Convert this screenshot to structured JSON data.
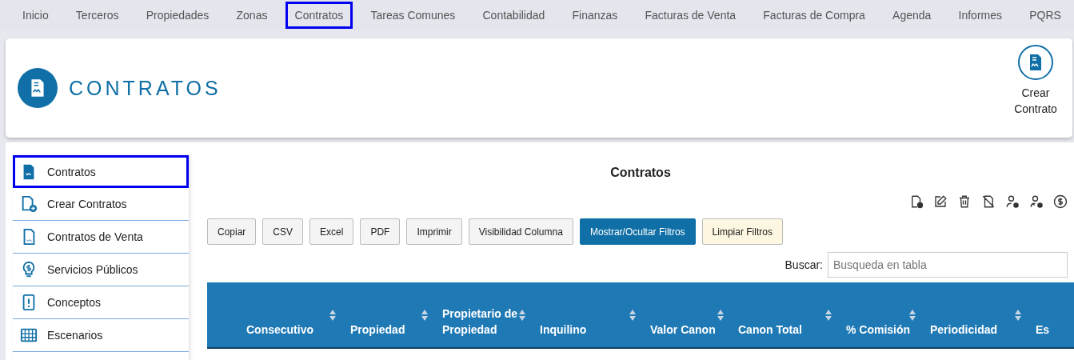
{
  "nav": [
    {
      "label": "Inicio",
      "selected": false
    },
    {
      "label": "Terceros",
      "selected": false
    },
    {
      "label": "Propiedades",
      "selected": false
    },
    {
      "label": "Zonas",
      "selected": false
    },
    {
      "label": "Contratos",
      "selected": true
    },
    {
      "label": "Tareas Comunes",
      "selected": false
    },
    {
      "label": "Contabilidad",
      "selected": false
    },
    {
      "label": "Finanzas",
      "selected": false
    },
    {
      "label": "Facturas de Venta",
      "selected": false
    },
    {
      "label": "Facturas de Compra",
      "selected": false
    },
    {
      "label": "Agenda",
      "selected": false
    },
    {
      "label": "Informes",
      "selected": false
    },
    {
      "label": "PQRS",
      "selected": false
    }
  ],
  "header": {
    "title": "CONTRATOS",
    "action": "Crear Contrato"
  },
  "sidebar": {
    "items": [
      {
        "label": "Contratos",
        "selected": true
      },
      {
        "label": "Crear Contratos",
        "selected": false
      },
      {
        "label": "Contratos de Venta",
        "selected": false
      },
      {
        "label": "Servicios Públicos",
        "selected": false
      },
      {
        "label": "Conceptos",
        "selected": false
      },
      {
        "label": "Escenarios",
        "selected": false
      }
    ]
  },
  "main": {
    "title": "Contratos",
    "buttons": [
      {
        "label": "Copiar",
        "kind": "default"
      },
      {
        "label": "CSV",
        "kind": "default"
      },
      {
        "label": "Excel",
        "kind": "default"
      },
      {
        "label": "PDF",
        "kind": "default"
      },
      {
        "label": "Imprimir",
        "kind": "default"
      },
      {
        "label": "Visibilidad Columna",
        "kind": "default"
      },
      {
        "label": "Mostrar/Ocultar Filtros",
        "kind": "primary"
      },
      {
        "label": "Limpiar Filtros",
        "kind": "warning"
      }
    ],
    "search": {
      "label": "Buscar:",
      "placeholder": "Busqueda en tabla"
    },
    "table": {
      "columns": [
        "Consecutivo",
        "Propiedad",
        "Propietario de Propiedad",
        "Inquilino",
        "Valor Canon",
        "Canon Total",
        "% Comisión",
        "Periodicidad",
        "Es"
      ]
    }
  }
}
